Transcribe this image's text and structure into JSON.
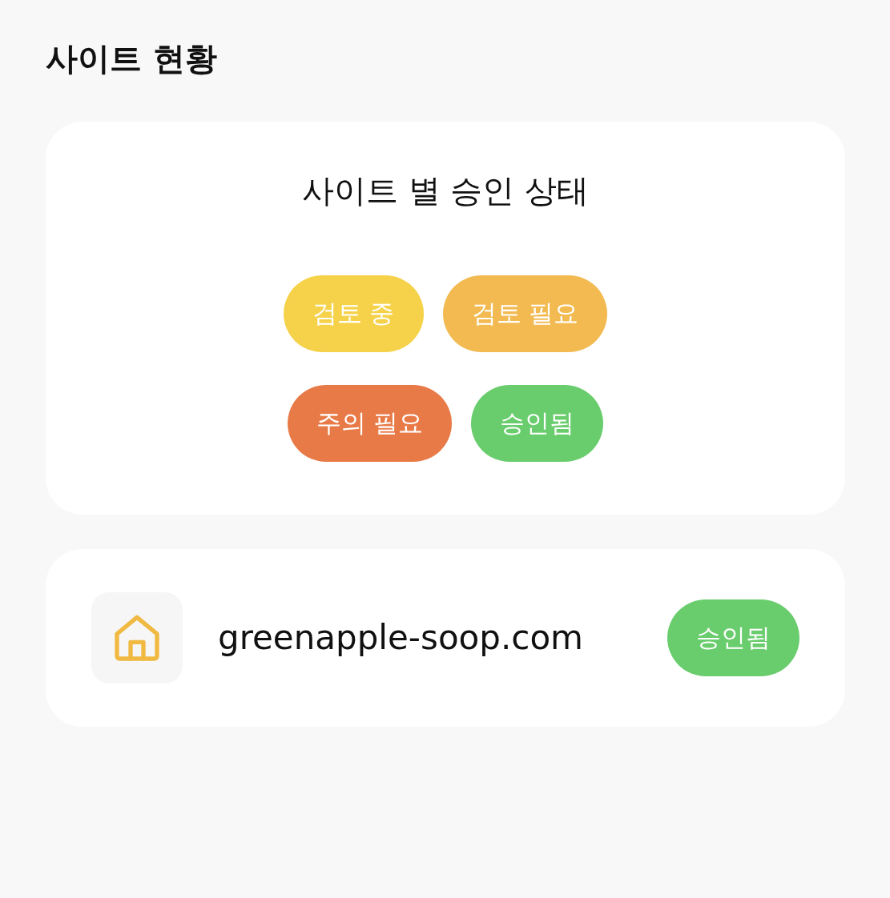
{
  "page": {
    "title": "사이트 현황"
  },
  "status_card": {
    "title": "사이트 별 승인 상태",
    "legend": [
      {
        "label": "검토 중",
        "color": "#f5d24a"
      },
      {
        "label": "검토 필요",
        "color": "#f2ba50"
      },
      {
        "label": "주의 필요",
        "color": "#e87a47"
      },
      {
        "label": "승인됨",
        "color": "#69cd6d"
      }
    ]
  },
  "sites": [
    {
      "domain": "greenapple-soop.com",
      "status": {
        "label": "승인됨",
        "color": "#69cd6d"
      }
    }
  ]
}
